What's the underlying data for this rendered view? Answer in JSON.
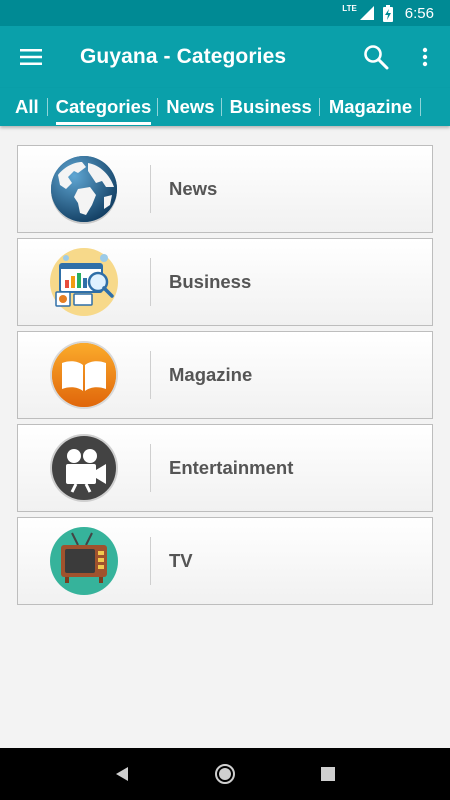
{
  "status_bar": {
    "network": "LTE",
    "time": "6:56",
    "icons": [
      "signal-icon",
      "battery-charging-icon"
    ]
  },
  "app_bar": {
    "title": "Guyana - Categories",
    "menu_icon": "hamburger-menu-icon",
    "search_icon": "search-icon",
    "more_icon": "more-vert-icon",
    "color": "#0aa0aa"
  },
  "tabs": [
    {
      "label": "All",
      "active": false
    },
    {
      "label": "Categories",
      "active": true
    },
    {
      "label": "News",
      "active": false
    },
    {
      "label": "Business",
      "active": false
    },
    {
      "label": "Magazine",
      "active": false
    }
  ],
  "categories": [
    {
      "label": "News",
      "icon": "globe-icon"
    },
    {
      "label": "Business",
      "icon": "business-dashboard-icon"
    },
    {
      "label": "Magazine",
      "icon": "open-book-icon"
    },
    {
      "label": "Entertainment",
      "icon": "movie-camera-icon"
    },
    {
      "label": "TV",
      "icon": "television-icon"
    }
  ],
  "nav_bar": {
    "icons": [
      "back-icon",
      "home-icon",
      "recents-icon"
    ]
  }
}
